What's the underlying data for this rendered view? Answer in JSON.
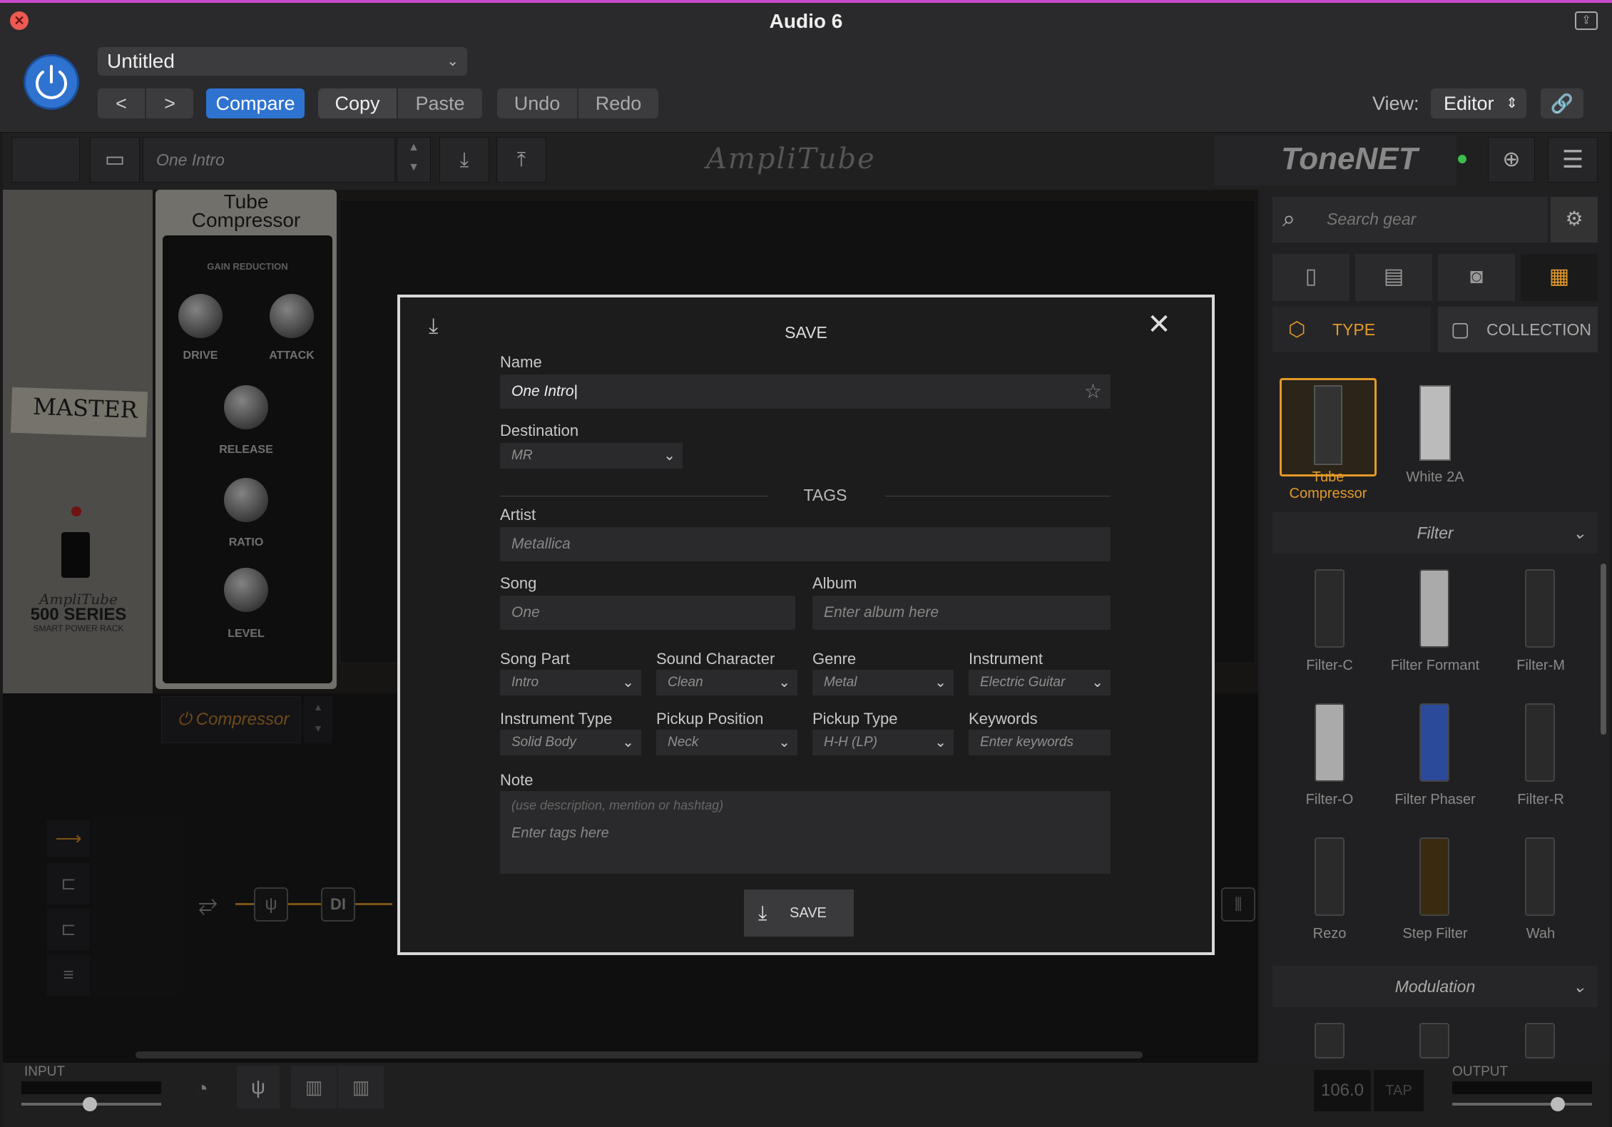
{
  "window": {
    "title": "Audio 6"
  },
  "host": {
    "preset_name": "Untitled",
    "prev": "<",
    "next": ">",
    "compare": "Compare",
    "copy": "Copy",
    "paste": "Paste",
    "undo": "Undo",
    "redo": "Redo",
    "view_label": "View:",
    "view_value": "Editor"
  },
  "toolbar": {
    "preset_field": "One Intro",
    "logo": "AmpliTube",
    "tonenet": "ToneNET"
  },
  "rack": {
    "master_tape": "MASTER",
    "series_brand": "AmpliTube",
    "series": "500 SERIES",
    "series_sub": "SMART POWER RACK",
    "unit_title_1": "Tube",
    "unit_title_2": "Compressor",
    "gain_reduction": "GAIN REDUCTION",
    "knobs": [
      "DRIVE",
      "ATTACK",
      "RELEASE",
      "RATIO",
      "LEVEL"
    ],
    "slot_label": "Compressor"
  },
  "chain": {
    "di": "DI"
  },
  "bottom": {
    "input": "INPUT",
    "output": "OUTPUT",
    "bpm": "106.0",
    "tap": "TAP"
  },
  "sidebar": {
    "search_placeholder": "Search gear",
    "type_tab": "TYPE",
    "collection_tab": "COLLECTION",
    "top_items": [
      "Tube\nCompressor",
      "White 2A"
    ],
    "filter_header": "Filter",
    "filter_items": [
      "Filter-C",
      "Filter Formant",
      "Filter-M",
      "Filter-O",
      "Filter Phaser",
      "Filter-R",
      "Rezo",
      "Step Filter",
      "Wah"
    ],
    "modulation_header": "Modulation"
  },
  "dialog": {
    "title": "SAVE",
    "name_label": "Name",
    "name_value": "One Intro",
    "destination_label": "Destination",
    "destination_value": "MR",
    "tags_header": "TAGS",
    "artist_label": "Artist",
    "artist_value": "Metallica",
    "song_label": "Song",
    "song_value": "One",
    "album_label": "Album",
    "album_placeholder": "Enter album here",
    "song_part_label": "Song Part",
    "song_part_value": "Intro",
    "sound_character_label": "Sound Character",
    "sound_character_value": "Clean",
    "genre_label": "Genre",
    "genre_value": "Metal",
    "instrument_label": "Instrument",
    "instrument_value": "Electric Guitar",
    "instrument_type_label": "Instrument Type",
    "instrument_type_value": "Solid Body",
    "pickup_position_label": "Pickup Position",
    "pickup_position_value": "Neck",
    "pickup_type_label": "Pickup Type",
    "pickup_type_value": "H-H (LP)",
    "keywords_label": "Keywords",
    "keywords_placeholder": "Enter keywords",
    "note_label": "Note",
    "note_hint": "(use description, mention or hashtag)",
    "note_placeholder": "Enter tags here",
    "save_button": "SAVE"
  },
  "colors": {
    "accent_blue": "#2f73d1",
    "accent_orange": "#e39a28"
  }
}
